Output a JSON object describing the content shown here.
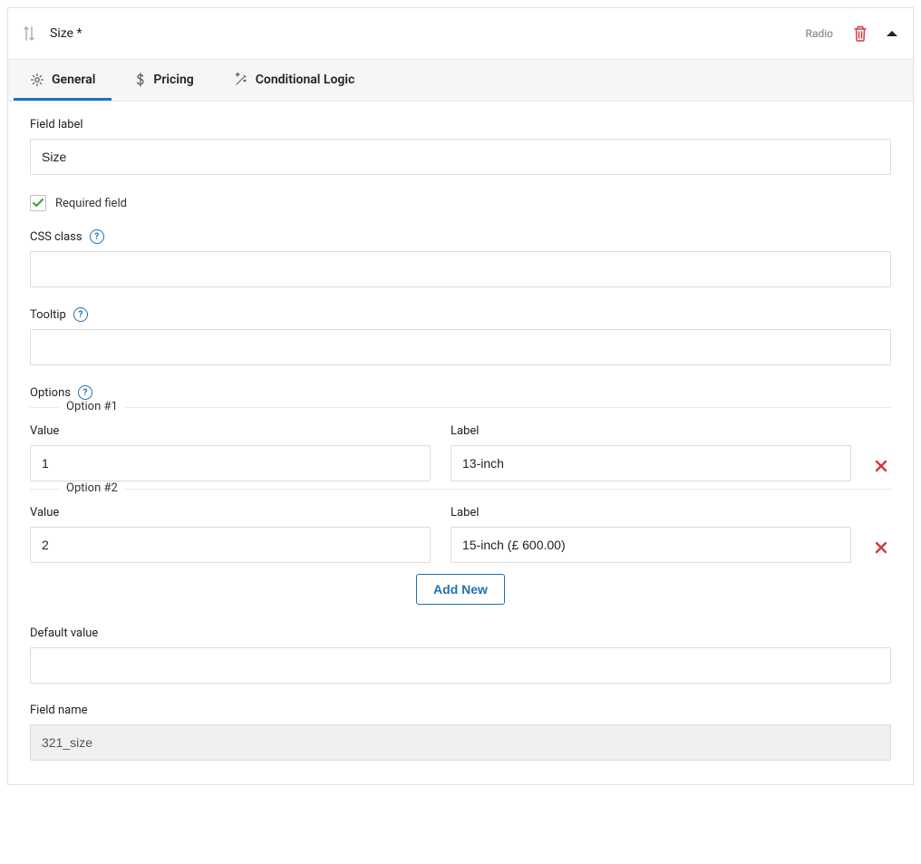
{
  "header": {
    "title": "Size *",
    "type": "Radio"
  },
  "tabs": {
    "general": "General",
    "pricing": "Pricing",
    "conditional": "Conditional Logic"
  },
  "labels": {
    "field_label": "Field label",
    "required": "Required field",
    "css_class": "CSS class",
    "tooltip": "Tooltip",
    "options": "Options",
    "value": "Value",
    "label": "Label",
    "add_new": "Add New",
    "default_value": "Default value",
    "field_name": "Field name"
  },
  "values": {
    "field_label": "Size",
    "css_class": "",
    "tooltip": "",
    "default_value": "",
    "field_name": "321_size"
  },
  "options": [
    {
      "legend": "Option #1",
      "value": "1",
      "label": "13-inch"
    },
    {
      "legend": "Option #2",
      "value": "2",
      "label": "15-inch (£ 600.00)"
    }
  ]
}
